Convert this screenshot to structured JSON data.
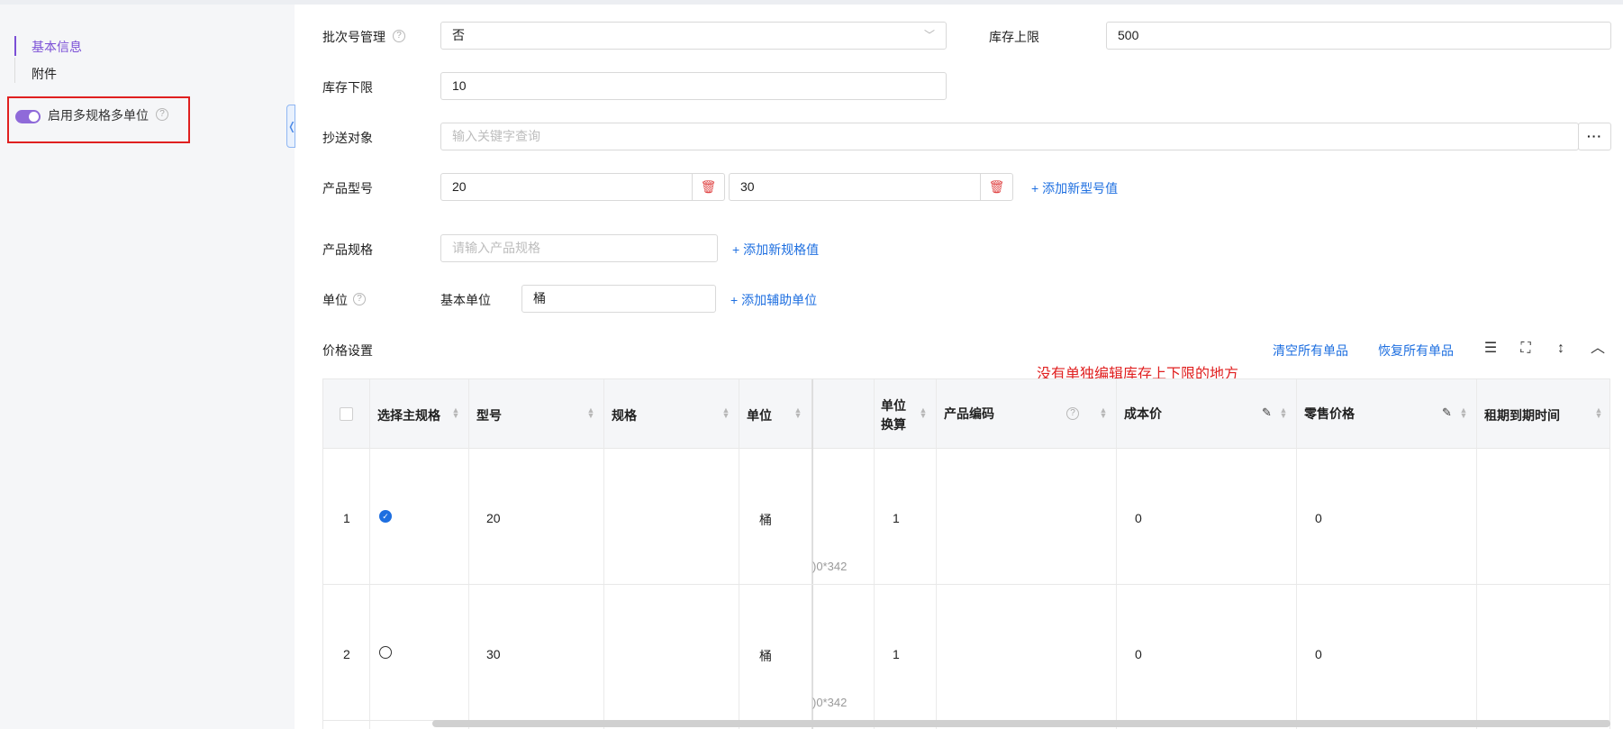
{
  "sidebar": {
    "items": [
      {
        "label": "基本信息",
        "active": true
      },
      {
        "label": "附件",
        "active": false
      }
    ],
    "toggle": {
      "label": "启用多规格多单位",
      "on": true
    }
  },
  "form": {
    "batch": {
      "label": "批次号管理",
      "value": "否"
    },
    "stock_max": {
      "label": "库存上限",
      "value": "500"
    },
    "stock_min": {
      "label": "库存下限",
      "value": "10"
    },
    "cc": {
      "label": "抄送对象",
      "placeholder": "输入关键字查询",
      "more": "···"
    },
    "model": {
      "label": "产品型号",
      "values": [
        "20",
        "30"
      ],
      "add_link": "+ 添加新型号值"
    },
    "spec": {
      "label": "产品规格",
      "placeholder": "请输入产品规格",
      "add_link": "+ 添加新规格值"
    },
    "unit": {
      "label": "单位",
      "base_label": "基本单位",
      "base_value": "桶",
      "add_link": "+ 添加辅助单位"
    }
  },
  "price": {
    "title": "价格设置",
    "clear_link": "清空所有单品",
    "restore_link": "恢复所有单品",
    "note": "没有单独编辑库存上下限的地方"
  },
  "table": {
    "headers": {
      "main_spec": "选择主规格",
      "model": "型号",
      "spec": "规格",
      "unit": "单位",
      "conv_line1": "单位",
      "conv_line2": "换算",
      "code": "产品编码",
      "cost": "成本价",
      "retail": "零售价格",
      "lease": "租期到期时间"
    },
    "rows": [
      {
        "idx": "1",
        "main": true,
        "model": "20",
        "unit": "桶",
        "partial": ")0*342",
        "conv": "1",
        "cost": "0",
        "retail": "0"
      },
      {
        "idx": "2",
        "main": false,
        "model": "30",
        "unit": "桶",
        "partial": ")0*342",
        "conv": "1",
        "cost": "0",
        "retail": "0"
      }
    ]
  },
  "colors": {
    "accent": "#7b4fd6",
    "link": "#1e6fe0",
    "danger": "#e02020"
  }
}
